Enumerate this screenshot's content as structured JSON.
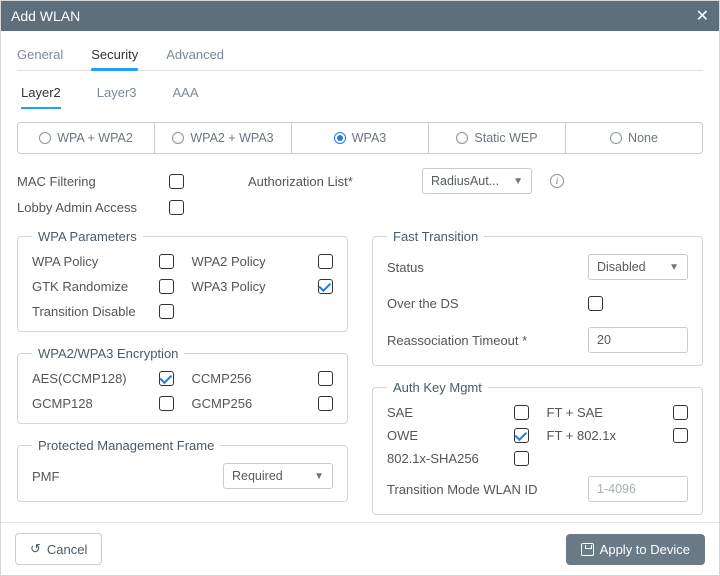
{
  "title": "Add WLAN",
  "tabs": {
    "general": "General",
    "security": "Security",
    "advanced": "Advanced"
  },
  "subtabs": {
    "layer2": "Layer2",
    "layer3": "Layer3",
    "aaa": "AAA"
  },
  "sec_modes": {
    "wpa_wpa2": "WPA + WPA2",
    "wpa2_wpa3": "WPA2 + WPA3",
    "wpa3": "WPA3",
    "static_wep": "Static WEP",
    "none": "None",
    "selected": "wpa3"
  },
  "mac_filtering_label": "MAC Filtering",
  "mac_filtering_checked": false,
  "auth_list_label": "Authorization List*",
  "auth_list_value": "RadiusAut...",
  "lobby_admin_label": "Lobby Admin Access",
  "lobby_admin_checked": false,
  "wpa_params": {
    "legend": "WPA Parameters",
    "wpa_policy": "WPA Policy",
    "wpa2_policy": "WPA2 Policy",
    "gtk": "GTK Randomize",
    "wpa3_policy": "WPA3 Policy",
    "transition_disable": "Transition Disable",
    "wpa_policy_checked": false,
    "wpa2_policy_checked": false,
    "gtk_checked": false,
    "wpa3_policy_checked": true,
    "transition_disable_checked": false
  },
  "encryption": {
    "legend": "WPA2/WPA3 Encryption",
    "aes": "AES(CCMP128)",
    "ccmp256": "CCMP256",
    "gcmp128": "GCMP128",
    "gcmp256": "GCMP256",
    "aes_checked": true,
    "ccmp256_checked": false,
    "gcmp128_checked": false,
    "gcmp256_checked": false
  },
  "pmf": {
    "legend": "Protected Management Frame",
    "label": "PMF",
    "value": "Required"
  },
  "ft": {
    "legend": "Fast Transition",
    "status_label": "Status",
    "status_value": "Disabled",
    "over_ds_label": "Over the DS",
    "over_ds_checked": false,
    "reassoc_label": "Reassociation Timeout *",
    "reassoc_value": "20"
  },
  "akm": {
    "legend": "Auth Key Mgmt",
    "sae": "SAE",
    "sae_checked": false,
    "ft_sae": "FT + SAE",
    "ft_sae_checked": false,
    "owe": "OWE",
    "owe_checked": true,
    "ft_8021x": "FT + 802.1x",
    "ft_8021x_checked": false,
    "sha256": "802.1x-SHA256",
    "sha256_checked": false,
    "tm_label": "Transition Mode WLAN ID",
    "tm_placeholder": "1-4096"
  },
  "footer": {
    "cancel": "Cancel",
    "apply": "Apply to Device"
  }
}
